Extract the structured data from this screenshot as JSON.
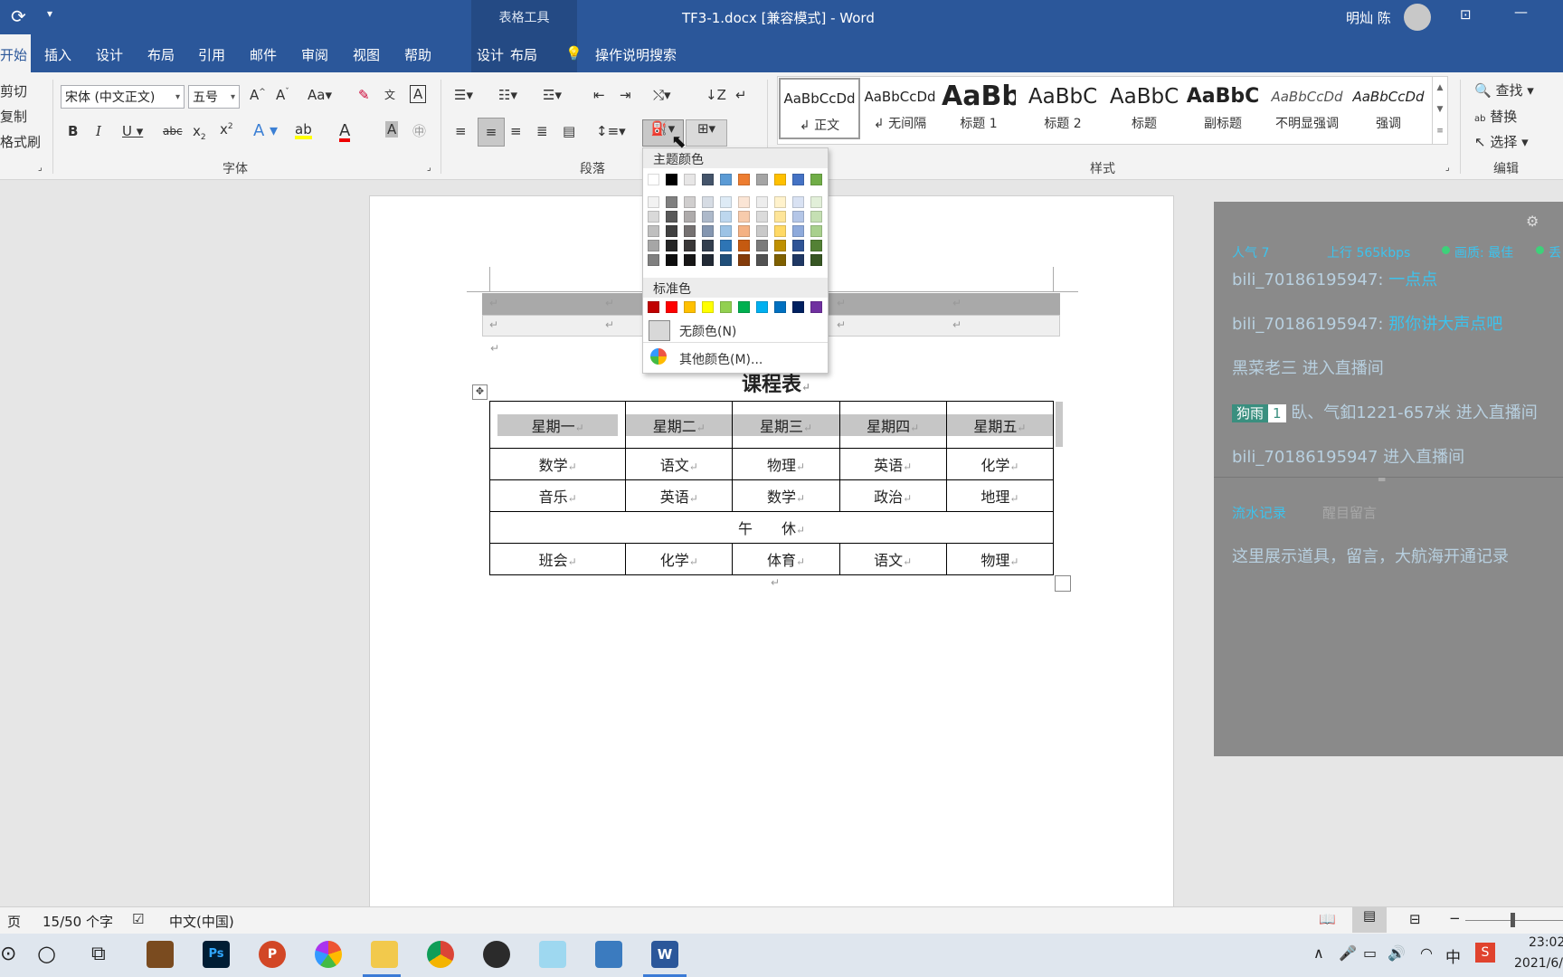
{
  "titlebar": {
    "context_tools": "表格工具",
    "doc_title": "TF3-1.docx [兼容模式] - Word",
    "user": "明灿 陈"
  },
  "tabs": [
    "开始",
    "插入",
    "设计",
    "布局",
    "引用",
    "邮件",
    "审阅",
    "视图",
    "帮助"
  ],
  "context_tabs": [
    "设计",
    "布局"
  ],
  "tell_me": "操作说明搜索",
  "clipboard": {
    "cut": "剪切",
    "copy": "复制",
    "format_painter": "格式刷"
  },
  "font": {
    "name": "宋体 (中文正文)",
    "size": "五号",
    "group_label": "字体"
  },
  "paragraph": {
    "group_label": "段落"
  },
  "styles": {
    "group_label": "样式",
    "items": [
      {
        "preview": "AaBbCcDd",
        "name": "正文"
      },
      {
        "preview": "AaBbCcDd",
        "name": "无间隔"
      },
      {
        "preview": "AaBb",
        "name": "标题 1"
      },
      {
        "preview": "AaBbC",
        "name": "标题 2"
      },
      {
        "preview": "AaBbC",
        "name": "标题"
      },
      {
        "preview": "AaBbC",
        "name": "副标题"
      },
      {
        "preview": "AaBbCcDd",
        "name": "不明显强调"
      },
      {
        "preview": "AaBbCcDd",
        "name": "强调"
      }
    ]
  },
  "editing": {
    "find": "查找",
    "replace": "替换",
    "select": "选择",
    "group_label": "编辑"
  },
  "shading_dropdown": {
    "theme_header": "主题颜色",
    "standard_header": "标准色",
    "no_color": "无颜色(N)",
    "more_colors": "其他颜色(M)...",
    "theme_top": [
      "#ffffff",
      "#000000",
      "#e7e6e6",
      "#44546a",
      "#5b9bd5",
      "#ed7d31",
      "#a5a5a5",
      "#ffc000",
      "#4472c4",
      "#70ad47"
    ],
    "theme_shades": [
      [
        "#f2f2f2",
        "#d9d9d9",
        "#bfbfbf",
        "#a6a6a6",
        "#808080"
      ],
      [
        "#808080",
        "#595959",
        "#404040",
        "#262626",
        "#0d0d0d"
      ],
      [
        "#d0cece",
        "#aeabab",
        "#757171",
        "#3a3838",
        "#171616"
      ],
      [
        "#d6dce4",
        "#adb9ca",
        "#8496b0",
        "#333f4f",
        "#222a35"
      ],
      [
        "#deebf6",
        "#bdd7ee",
        "#9cc3e5",
        "#2e75b5",
        "#1f4e79"
      ],
      [
        "#fbe5d5",
        "#f7cbac",
        "#f4b183",
        "#c55a11",
        "#843c0b"
      ],
      [
        "#ededed",
        "#dbdbdb",
        "#c9c9c9",
        "#7b7b7b",
        "#525252"
      ],
      [
        "#fff2cc",
        "#fee599",
        "#ffd965",
        "#bf9000",
        "#7f6000"
      ],
      [
        "#d9e2f3",
        "#b4c6e7",
        "#8eaadb",
        "#2f5496",
        "#1f3864"
      ],
      [
        "#e2efd9",
        "#c5e0b3",
        "#a8d08d",
        "#538135",
        "#375623"
      ]
    ],
    "standard": [
      "#c00000",
      "#ff0000",
      "#ffc000",
      "#ffff00",
      "#92d050",
      "#00b050",
      "#00b0f0",
      "#0070c0",
      "#002060",
      "#7030a0"
    ]
  },
  "document": {
    "title": "课程表",
    "table": {
      "header": [
        "星期一",
        "星期二",
        "星期三",
        "星期四",
        "星期五"
      ],
      "rows": [
        [
          "数学",
          "语文",
          "物理",
          "英语",
          "化学"
        ],
        [
          "音乐",
          "英语",
          "数学",
          "政治",
          "地理"
        ],
        [
          "午　　休"
        ],
        [
          "班会",
          "化学",
          "体育",
          "语文",
          "物理"
        ]
      ]
    }
  },
  "sidepanel": {
    "stats": {
      "popularity": "人气  7",
      "upload": "上行  565kbps",
      "quality": "画质: 最佳",
      "extra": "丢"
    },
    "chat": [
      {
        "user": "bili_70186195947:",
        "msg": "一点点"
      },
      {
        "user": "bili_70186195947:",
        "msg": "那你讲大声点吧"
      },
      {
        "user": "黑菜老三",
        "msg": "进入直播间"
      },
      {
        "badge": "狗雨",
        "level": "1",
        "user": "臥、气釦1221-657米",
        "msg": "进入直播间"
      },
      {
        "user": "bili_70186195947",
        "msg": "进入直播间"
      }
    ],
    "tabs": [
      "流水记录",
      "醒目留言"
    ],
    "placeholder": "这里展示道具，留言，大航海开通记录"
  },
  "statusbar": {
    "page": "页",
    "words": "15/50 个字",
    "lang": "中文(中国)"
  },
  "taskbar": {
    "time": "23:02",
    "date": "2021/6/",
    "ime": "中"
  }
}
